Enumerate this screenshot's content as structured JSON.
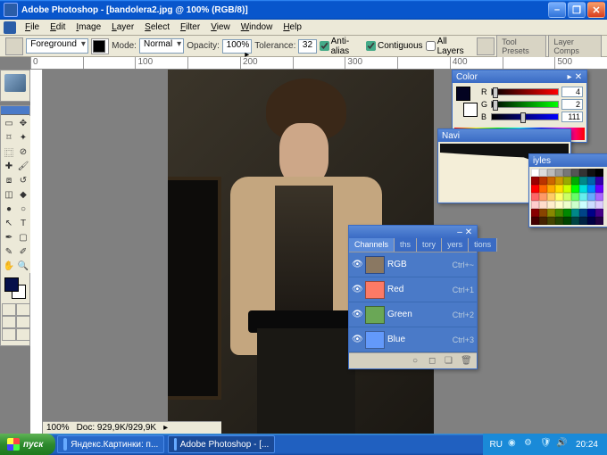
{
  "titlebar": {
    "text": "Adobe Photoshop - [bandolera2.jpg @ 100% (RGB/8)]"
  },
  "menu": {
    "items": [
      "File",
      "Edit",
      "Image",
      "Layer",
      "Select",
      "Filter",
      "View",
      "Window",
      "Help"
    ]
  },
  "options": {
    "fill_label": "Foreground",
    "mode_label": "Mode:",
    "mode_value": "Normal",
    "opacity_label": "Opacity:",
    "opacity_value": "100% ▸",
    "tolerance_label": "Tolerance:",
    "tolerance_value": "32",
    "antialias": "Anti-alias",
    "contiguous": "Contiguous",
    "alllayers": "All Layers",
    "right_tabs": [
      "Tool Presets",
      "Layer Comps"
    ]
  },
  "ruler_ticks": [
    "0",
    "",
    "100",
    "",
    "200",
    "",
    "300",
    "",
    "400",
    "",
    "500"
  ],
  "doc_status": {
    "zoom": "100%",
    "size": "Doc: 929,9K/929,9K"
  },
  "color_panel": {
    "title": "Color",
    "r_label": "R",
    "r_value": "4",
    "g_label": "G",
    "g_value": "2",
    "b_label": "B",
    "b_value": "111"
  },
  "nav_panel": {
    "tab": "Navi"
  },
  "swatch_panel": {
    "tab": "iyles",
    "colors": [
      "#fff",
      "#ddd",
      "#bbb",
      "#999",
      "#777",
      "#555",
      "#333",
      "#111",
      "#000",
      "#900",
      "#b30",
      "#c60",
      "#c90",
      "#9a0",
      "#0a0",
      "#088",
      "#06a",
      "#30a",
      "#f00",
      "#f60",
      "#fa0",
      "#fd0",
      "#cf0",
      "#0f0",
      "#0dd",
      "#08f",
      "#60f",
      "#f66",
      "#f96",
      "#fc6",
      "#ff6",
      "#cf6",
      "#6f6",
      "#6ee",
      "#6af",
      "#a6f",
      "#fcc",
      "#fdc",
      "#fec",
      "#ffc",
      "#efc",
      "#cfc",
      "#cff",
      "#cdf",
      "#dcf",
      "#800",
      "#840",
      "#880",
      "#480",
      "#080",
      "#088",
      "#048",
      "#008",
      "#408",
      "#400",
      "#420",
      "#440",
      "#240",
      "#040",
      "#044",
      "#024",
      "#004",
      "#204"
    ]
  },
  "channels_panel": {
    "tabs": [
      "Channels",
      "ths",
      "tory",
      "yers",
      "tions"
    ],
    "rows": [
      {
        "name": "RGB",
        "shortcut": "Ctrl+~",
        "cls": ""
      },
      {
        "name": "Red",
        "shortcut": "Ctrl+1",
        "cls": "r"
      },
      {
        "name": "Green",
        "shortcut": "Ctrl+2",
        "cls": "g"
      },
      {
        "name": "Blue",
        "shortcut": "Ctrl+3",
        "cls": "b"
      }
    ]
  },
  "taskbar": {
    "start": "пуск",
    "items": [
      "Яндекс.Картинки: п...",
      "Adobe Photoshop - [..."
    ],
    "lang": "RU",
    "time": "20:24"
  }
}
